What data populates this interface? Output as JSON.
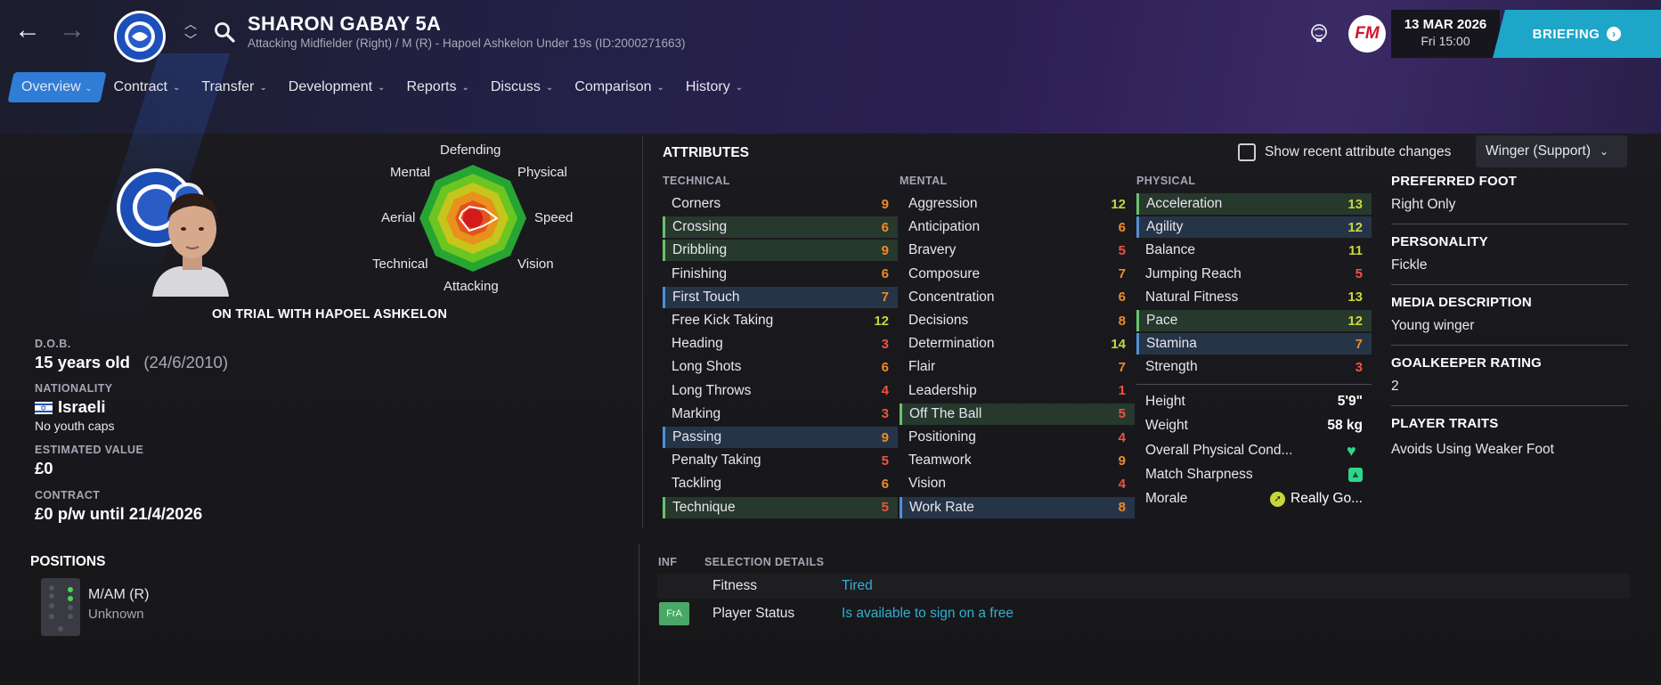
{
  "header": {
    "player_name": "SHARON GABAY 5A",
    "player_subtitle": "Attacking Midfielder (Right) / M (R) - Hapoel Ashkelon Under 19s (ID:2000271663)",
    "date": "13 MAR 2026",
    "day_time": "Fri 15:00",
    "briefing_label": "BRIEFING",
    "fm_logo": "FM"
  },
  "tabs": [
    "Overview",
    "Contract",
    "Transfer",
    "Development",
    "Reports",
    "Discuss",
    "Comparison",
    "History"
  ],
  "radar": {
    "labels": {
      "defending": "Defending",
      "physical": "Physical",
      "speed": "Speed",
      "vision": "Vision",
      "attacking": "Attacking",
      "technical": "Technical",
      "aerial": "Aerial",
      "mental": "Mental"
    }
  },
  "profile": {
    "trial_text": "ON TRIAL WITH HAPOEL ASHKELON",
    "dob_label": "D.O.B.",
    "age": "15 years old",
    "dob": "(24/6/2010)",
    "nationality_label": "NATIONALITY",
    "nationality": "Israeli",
    "youth_caps": "No youth caps",
    "value_label": "ESTIMATED VALUE",
    "value": "£0",
    "contract_label": "CONTRACT",
    "contract": "£0 p/w until 21/4/2026"
  },
  "attributes": {
    "title": "ATTRIBUTES",
    "show_changes_label": "Show recent attribute changes",
    "role": "Winger (Support)",
    "technical_label": "TECHNICAL",
    "mental_label": "MENTAL",
    "physical_label": "PHYSICAL",
    "technical": [
      {
        "name": "Corners",
        "value": "9",
        "hl": "",
        "c": "c-mid"
      },
      {
        "name": "Crossing",
        "value": "6",
        "hl": "hl-green",
        "c": "c-mid"
      },
      {
        "name": "Dribbling",
        "value": "9",
        "hl": "hl-green",
        "c": "c-mid"
      },
      {
        "name": "Finishing",
        "value": "6",
        "hl": "",
        "c": "c-mid"
      },
      {
        "name": "First Touch",
        "value": "7",
        "hl": "hl-blue",
        "c": "c-mid"
      },
      {
        "name": "Free Kick Taking",
        "value": "12",
        "hl": "",
        "c": "c-hi"
      },
      {
        "name": "Heading",
        "value": "3",
        "hl": "",
        "c": "c-low"
      },
      {
        "name": "Long Shots",
        "value": "6",
        "hl": "",
        "c": "c-mid"
      },
      {
        "name": "Long Throws",
        "value": "4",
        "hl": "",
        "c": "c-low"
      },
      {
        "name": "Marking",
        "value": "3",
        "hl": "",
        "c": "c-low"
      },
      {
        "name": "Passing",
        "value": "9",
        "hl": "hl-blue",
        "c": "c-mid"
      },
      {
        "name": "Penalty Taking",
        "value": "5",
        "hl": "",
        "c": "c-low"
      },
      {
        "name": "Tackling",
        "value": "6",
        "hl": "",
        "c": "c-mid"
      },
      {
        "name": "Technique",
        "value": "5",
        "hl": "hl-green",
        "c": "c-low"
      }
    ],
    "mental": [
      {
        "name": "Aggression",
        "value": "12",
        "hl": "",
        "c": "c-hi"
      },
      {
        "name": "Anticipation",
        "value": "6",
        "hl": "",
        "c": "c-mid"
      },
      {
        "name": "Bravery",
        "value": "5",
        "hl": "",
        "c": "c-low"
      },
      {
        "name": "Composure",
        "value": "7",
        "hl": "",
        "c": "c-mid"
      },
      {
        "name": "Concentration",
        "value": "6",
        "hl": "",
        "c": "c-mid"
      },
      {
        "name": "Decisions",
        "value": "8",
        "hl": "",
        "c": "c-mid"
      },
      {
        "name": "Determination",
        "value": "14",
        "hl": "",
        "c": "c-hi"
      },
      {
        "name": "Flair",
        "value": "7",
        "hl": "",
        "c": "c-mid"
      },
      {
        "name": "Leadership",
        "value": "1",
        "hl": "",
        "c": "c-low"
      },
      {
        "name": "Off The Ball",
        "value": "5",
        "hl": "hl-green",
        "c": "c-low"
      },
      {
        "name": "Positioning",
        "value": "4",
        "hl": "",
        "c": "c-low"
      },
      {
        "name": "Teamwork",
        "value": "9",
        "hl": "",
        "c": "c-mid"
      },
      {
        "name": "Vision",
        "value": "4",
        "hl": "",
        "c": "c-low"
      },
      {
        "name": "Work Rate",
        "value": "8",
        "hl": "hl-blue",
        "c": "c-mid"
      }
    ],
    "physical": [
      {
        "name": "Acceleration",
        "value": "13",
        "hl": "hl-green",
        "c": "c-hi"
      },
      {
        "name": "Agility",
        "value": "12",
        "hl": "hl-blue",
        "c": "c-hi"
      },
      {
        "name": "Balance",
        "value": "11",
        "hl": "",
        "c": "c-hi"
      },
      {
        "name": "Jumping Reach",
        "value": "5",
        "hl": "",
        "c": "c-low"
      },
      {
        "name": "Natural Fitness",
        "value": "13",
        "hl": "",
        "c": "c-hi"
      },
      {
        "name": "Pace",
        "value": "12",
        "hl": "hl-green",
        "c": "c-hi"
      },
      {
        "name": "Stamina",
        "value": "7",
        "hl": "hl-blue",
        "c": "c-mid"
      },
      {
        "name": "Strength",
        "value": "3",
        "hl": "",
        "c": "c-low"
      }
    ],
    "extra": {
      "height_label": "Height",
      "height": "5'9\"",
      "weight_label": "Weight",
      "weight": "58 kg",
      "condition_label": "Overall Physical Cond...",
      "sharpness_label": "Match Sharpness",
      "morale_label": "Morale",
      "morale": "Really Go..."
    }
  },
  "info": {
    "foot_label": "PREFERRED FOOT",
    "foot": "Right Only",
    "personality_label": "PERSONALITY",
    "personality": "Fickle",
    "media_label": "MEDIA DESCRIPTION",
    "media": "Young winger",
    "gk_label": "GOALKEEPER RATING",
    "gk": "2",
    "traits_label": "PLAYER TRAITS",
    "traits": "Avoids Using Weaker Foot"
  },
  "positions": {
    "title": "POSITIONS",
    "name": "M/AM (R)",
    "rating": "Unknown"
  },
  "selection": {
    "inf_label": "INF",
    "title": "SELECTION DETAILS",
    "fitness_label": "Fitness",
    "fitness": "Tired",
    "fra_badge": "FrA",
    "status_label": "Player Status",
    "status": "Is available to sign on a free"
  },
  "colors": {
    "accent_blue": "#2f7dd6",
    "briefing": "#1ea6c8",
    "attr_low": "#f0533f",
    "attr_mid": "#f08a27",
    "attr_high": "#c8d63b",
    "status_teal": "#2fb0d0"
  }
}
